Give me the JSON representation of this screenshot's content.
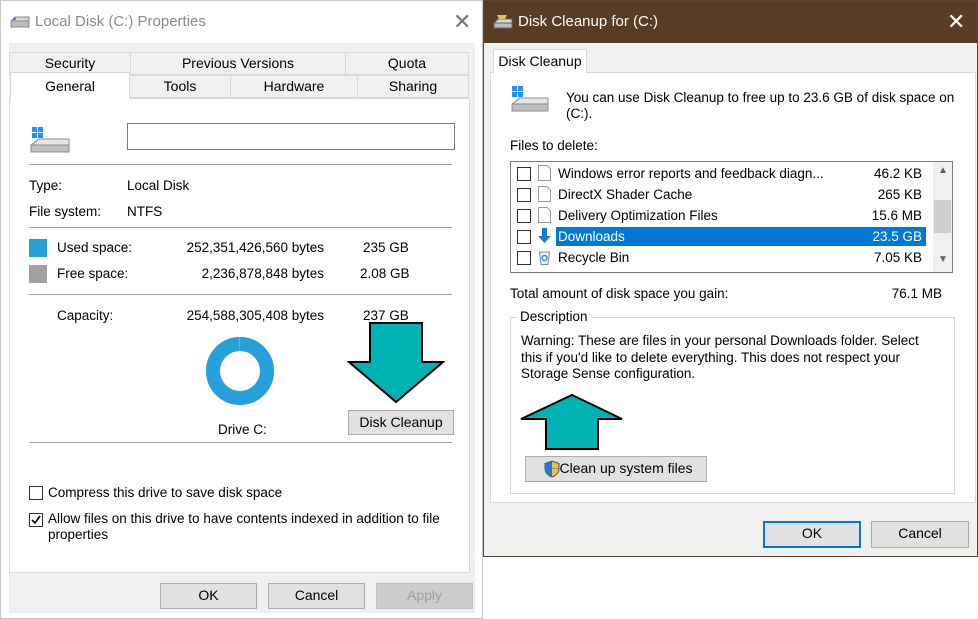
{
  "props": {
    "title": "Local Disk (C:) Properties",
    "tabs_row1": [
      "Security",
      "Previous Versions",
      "Quota"
    ],
    "tabs_row2": [
      "General",
      "Tools",
      "Hardware",
      "Sharing"
    ],
    "name_value": "",
    "type_label": "Type:",
    "type_value": "Local Disk",
    "fs_label": "File system:",
    "fs_value": "NTFS",
    "used_label": "Used space:",
    "used_bytes": "252,351,426,560 bytes",
    "used_gb": "235 GB",
    "free_label": "Free space:",
    "free_bytes": "2,236,878,848 bytes",
    "free_gb": "2.08 GB",
    "capacity_label": "Capacity:",
    "capacity_bytes": "254,588,305,408 bytes",
    "capacity_gb": "237 GB",
    "drive_label": "Drive C:",
    "disk_cleanup_button": "Disk Cleanup",
    "compress_label": "Compress this drive to save disk space",
    "compress_checked": false,
    "index_label": "Allow files on this drive to have contents indexed in addition to file properties",
    "index_checked": true,
    "ok": "OK",
    "cancel": "Cancel",
    "apply": "Apply",
    "used_fraction": 0.991,
    "colors": {
      "used": "#26a0da",
      "free": "#a0a0a0",
      "arrow": "#00b3b3"
    }
  },
  "cleanup": {
    "title": "Disk Cleanup for  (C:)",
    "tab": "Disk Cleanup",
    "intro": "You can use Disk Cleanup to free up to 23.6 GB of disk space on (C:).",
    "files_to_delete_label": "Files to delete:",
    "files": [
      {
        "label": "Windows error reports and feedback diagn...",
        "size": "46.2 KB",
        "checked": false,
        "selected": false,
        "icon": "document-icon"
      },
      {
        "label": "DirectX Shader Cache",
        "size": "265 KB",
        "checked": false,
        "selected": false,
        "icon": "document-icon"
      },
      {
        "label": "Delivery Optimization Files",
        "size": "15.6 MB",
        "checked": false,
        "selected": false,
        "icon": "document-icon"
      },
      {
        "label": "Downloads",
        "size": "23.5 GB",
        "checked": false,
        "selected": true,
        "icon": "download-arrow-icon"
      },
      {
        "label": "Recycle Bin",
        "size": "7.05 KB",
        "checked": false,
        "selected": false,
        "icon": "recycle-bin-icon"
      }
    ],
    "total_label": "Total amount of disk space you gain:",
    "total_value": "76.1 MB",
    "description_label": "Description",
    "description_text": "Warning: These are files in your personal Downloads folder. Select this if you'd like to delete everything. This does not respect your Storage Sense configuration.",
    "cleanup_system_button": "Clean up system files",
    "ok": "OK",
    "cancel": "Cancel"
  },
  "close_glyph": "✕"
}
